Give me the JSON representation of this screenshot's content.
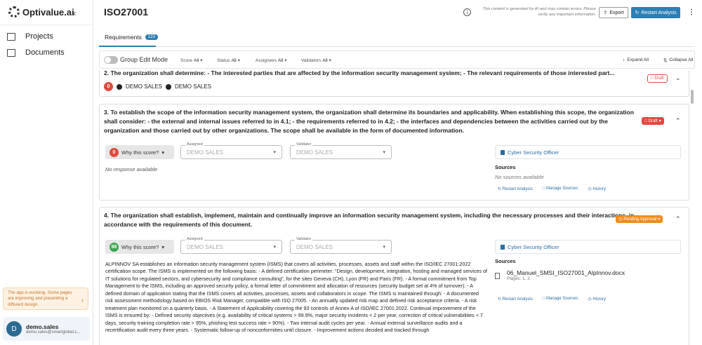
{
  "brand": {
    "name": "Optivalue.ai"
  },
  "sidebar": {
    "collapse_icon": "chevron-left",
    "items": [
      {
        "label": "Projects",
        "icon": "folder-icon"
      },
      {
        "label": "Documents",
        "icon": "documents-icon"
      }
    ],
    "notice": "The app is evolving. Some pages are improving and presenting a different design.",
    "user": {
      "initial": "D",
      "name": "demo.sales",
      "email": "demo.sales@smartglobal.c..."
    }
  },
  "header": {
    "title": "ISO27001",
    "disclaimer": "This content is generated by AI and may contain errors. Please verify any important information.",
    "export_label": "Export",
    "restart_label": "Restart Analysis"
  },
  "tabs": [
    {
      "label": "Requirements",
      "count": "123"
    }
  ],
  "filters": {
    "group_edit_label": "Group Edit Mode",
    "items": [
      {
        "name": "Score",
        "value": "All"
      },
      {
        "name": "Status",
        "value": "All"
      },
      {
        "name": "Assignees",
        "value": "All"
      },
      {
        "name": "Validators",
        "value": "All"
      }
    ],
    "expand_all": "Expand All",
    "collapse_all": "Collapse All"
  },
  "requirements": [
    {
      "text": "2.  The organization shall determine: - The interested parties that are affected by the information security management system; - The relevant requirements of those interested part...",
      "status": "Draft",
      "score": "0",
      "assignee": "DEMO SALES",
      "validator": "DEMO SALES"
    },
    {
      "text": "3.  To establish the scope of the information security management system, the organization shall determine its boundaries and applicability. When establishing this scope, the organization shall consider: - the external and internal issues referred to in 4.1; - the requirements referred to in 4.2; - the interfaces and dependencies between the activities carried out by the organization and those carried out by other organizations. The scope shall be available in the form of documented information.",
      "status": "Draft",
      "score": "0",
      "why_label": "Why this score?",
      "assigned_label": "Assigned",
      "assigned_value": "DEMO SALES",
      "validator_label": "Validator",
      "validator_value": "DEMO SALES",
      "role": "Cyber Security Officer",
      "response": "No response available",
      "sources_label": "Sources",
      "sources_empty": "No sources available",
      "actions": [
        "Restart Analysis",
        "Manage Sources",
        "History"
      ]
    },
    {
      "text": "4.  The organization shall establish, implement, maintain and continually improve an information security management system, including the necessary processes and their interactions, in accordance with the requirements of this document.",
      "status": "Pending Approval",
      "score": "88",
      "why_label": "Why this score?",
      "assigned_label": "Assigned",
      "assigned_value": "DEMO SALES",
      "validator_label": "Validator",
      "validator_value": "DEMO SALES",
      "role": "Cyber Security Officer",
      "response": "ALPINNOV SA establishes an information security management system (ISMS) that covers all activities, processes, assets and staff within the ISO/IEC 27001:2022 certification scope. The ISMS is implemented on the following basis: - A defined certification perimeter: “Design, development, integration, hosting and managed services of IT solutions for regulated sectors, and cybersecurity and compliance consulting”, for the sites Geneva (CH), Lyon (FR) and Paris (FR). - A formal commitment from Top Management to the ISMS, including an approved security policy, a formal letter of commitment and allocation of resources (security budget set at 4% of turnover). - A defined domain of application stating that the ISMS covers all activities, processes, assets and collaborators in scope. The ISMS is maintained through: - A documented risk assessment methodology based on EBIOS Risk Manager, compatible with ISO 27005. - An annually updated risk map and defined risk acceptance criteria. - A risk treatment plan monitored on a quarterly basis. - A Statement of Applicability covering the 93 controls of Annex A of ISO/IEC 27001:2022. Continual improvement of the ISMS is ensured by: - Defined security objectives (e.g. availability of critical systems > 99.9%, major security incidents < 2 per year, correction of critical vulnerabilities < 7 days, security training completion rate > 95%, phishing test success rate > 90%). - Two internal audit cycles per year. - Annual external surveillance audits and a recertification audit every three years. - Systematic follow-up of nonconformities until closure. - Improvement actions decided and tracked through",
      "sources_label": "Sources",
      "source_doc": {
        "name": "06_Manuel_SMSI_ISO27001_AlpInnov.docx",
        "pages": "Pages: 1, 2"
      },
      "actions": [
        "Restart Analysis",
        "Manage Sources",
        "History"
      ]
    }
  ],
  "colors": {
    "accent": "#2b7fb5",
    "draft": "#e04a3f",
    "pending": "#f08c1e",
    "score_good": "#3aa652"
  }
}
